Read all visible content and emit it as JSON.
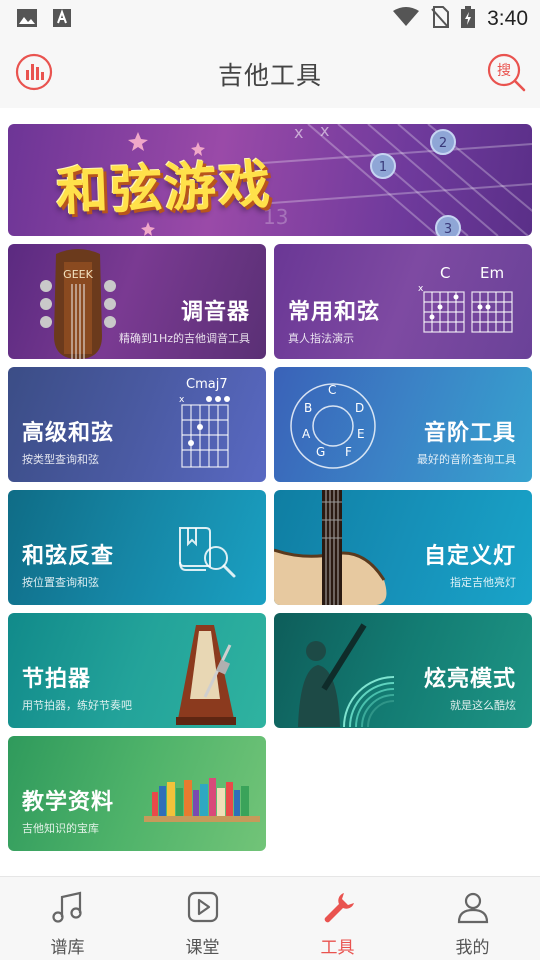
{
  "status_bar": {
    "time": "3:40"
  },
  "header": {
    "title": "吉他工具"
  },
  "banner": {
    "title": "和弦游戏"
  },
  "cards": [
    {
      "title": "调音器",
      "subtitle": "精确到1Hz的吉他调音工具"
    },
    {
      "title": "常用和弦",
      "subtitle": "真人指法演示",
      "chord_labels": [
        "C",
        "Em"
      ]
    },
    {
      "title": "高级和弦",
      "subtitle": "按类型查询和弦",
      "chord_label": "Cmaj7"
    },
    {
      "title": "音阶工具",
      "subtitle": "最好的音阶查询工具",
      "notes": [
        "C",
        "D",
        "E",
        "F",
        "G",
        "A",
        "B"
      ]
    },
    {
      "title": "和弦反查",
      "subtitle": "按位置查询和弦"
    },
    {
      "title": "自定义灯",
      "subtitle": "指定吉他亮灯"
    },
    {
      "title": "节拍器",
      "subtitle": "用节拍器，练好节奏吧"
    },
    {
      "title": "炫亮模式",
      "subtitle": "就是这么酷炫"
    },
    {
      "title": "教学资料",
      "subtitle": "吉他知识的宝库"
    }
  ],
  "nav": [
    {
      "label": "谱库",
      "icon": "music-note-icon"
    },
    {
      "label": "课堂",
      "icon": "play-icon"
    },
    {
      "label": "工具",
      "icon": "wrench-icon",
      "active": true
    },
    {
      "label": "我的",
      "icon": "user-icon"
    }
  ],
  "colors": {
    "accent": "#e9534f",
    "header_bg": "#f7f7f7"
  }
}
